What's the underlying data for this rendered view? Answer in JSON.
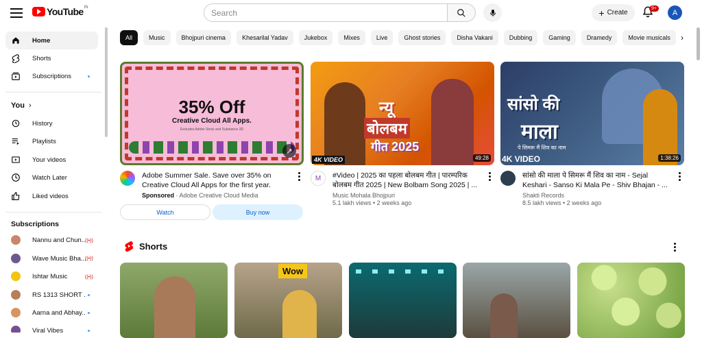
{
  "header": {
    "logo_text": "YouTube",
    "country_code": "IN",
    "search_placeholder": "Search",
    "create_label": "Create",
    "notifications_badge": "9+",
    "avatar_letter": "A"
  },
  "sidebar": {
    "main": [
      {
        "label": "Home",
        "icon": "home-icon",
        "active": true
      },
      {
        "label": "Shorts",
        "icon": "shorts-icon"
      },
      {
        "label": "Subscriptions",
        "icon": "subscriptions-icon"
      }
    ],
    "you_heading": "You",
    "you_items": [
      {
        "label": "History",
        "icon": "history-icon"
      },
      {
        "label": "Playlists",
        "icon": "playlists-icon"
      },
      {
        "label": "Your videos",
        "icon": "your-videos-icon"
      },
      {
        "label": "Watch Later",
        "icon": "watch-later-icon"
      },
      {
        "label": "Liked videos",
        "icon": "liked-icon"
      }
    ],
    "subs_heading": "Subscriptions",
    "subscriptions": [
      {
        "label": "Nannu and Chun...",
        "status": "live",
        "color": "#c9876a"
      },
      {
        "label": "Wave Music Bha...",
        "status": "live",
        "color": "#6b5a8f"
      },
      {
        "label": "Ishtar Music",
        "status": "live",
        "color": "#f1c40f"
      },
      {
        "label": "RS 1313 SHORT ...",
        "status": "new",
        "color": "#b87d5a"
      },
      {
        "label": "Aarna and Abhay...",
        "status": "new",
        "color": "#d9955f"
      },
      {
        "label": "Viral Vibes",
        "status": "new",
        "color": "#7a4d8f"
      }
    ]
  },
  "chips": [
    "All",
    "Music",
    "Bhojpuri cinema",
    "Khesarilal Yadav",
    "Jukebox",
    "Mixes",
    "Live",
    "Ghost stories",
    "Disha Vakani",
    "Dubbing",
    "Gaming",
    "Dramedy",
    "Movie musicals"
  ],
  "videos": [
    {
      "type": "ad",
      "thumb_headline": "35% Off",
      "thumb_sub": "Creative Cloud All Apps.",
      "thumb_fine": "Excludes Adobe Stock and Substance 3D",
      "title": "Adobe Summer Sale. Save over 35% on Creative Cloud All Apps for the first year.",
      "sponsored": "Sponsored",
      "advertiser": "Adobe Creative Cloud Media",
      "watch_label": "Watch",
      "buy_label": "Buy now"
    },
    {
      "type": "video",
      "thumb_text1": "न्यू",
      "thumb_text2": "बोलबम",
      "thumb_text3": "गीत 2025",
      "thumb_badge": "4K VIDEO",
      "duration": "49:28",
      "title": "#Video | 2025 का पहला बोलबम गीत | पारम्परिक बोलबम गीत 2025 | New Bolbam Song 2025 | ...",
      "channel": "Music Mohala Bhojpuri",
      "stats": "5.1 lakh views • 2 weeks ago"
    },
    {
      "type": "video",
      "thumb_text1": "सांसो की",
      "thumb_text2": "माला",
      "thumb_text3": "पे सिमरू मैं शिव का नाम",
      "thumb_badge": "4K VIDEO",
      "duration": "1:38:26",
      "title": "सांसो की माला पे सिमरू मैं शिव का नाम - Sejal Keshari - Sanso Ki Mala Pe - Shiv Bhajan - ...",
      "channel": "Shakti Records",
      "stats": "8.5 lakh views • 2 weeks ago"
    }
  ],
  "shorts": {
    "heading": "Shorts",
    "items": [
      {
        "tag": ""
      },
      {
        "tag": "Wow"
      },
      {
        "tag": ""
      },
      {
        "tag": ""
      },
      {
        "tag": ""
      }
    ]
  },
  "colors": {
    "brand_red": "#ff0000",
    "accent_blue": "#065fd4",
    "chip_bg": "#f2f2f2"
  }
}
